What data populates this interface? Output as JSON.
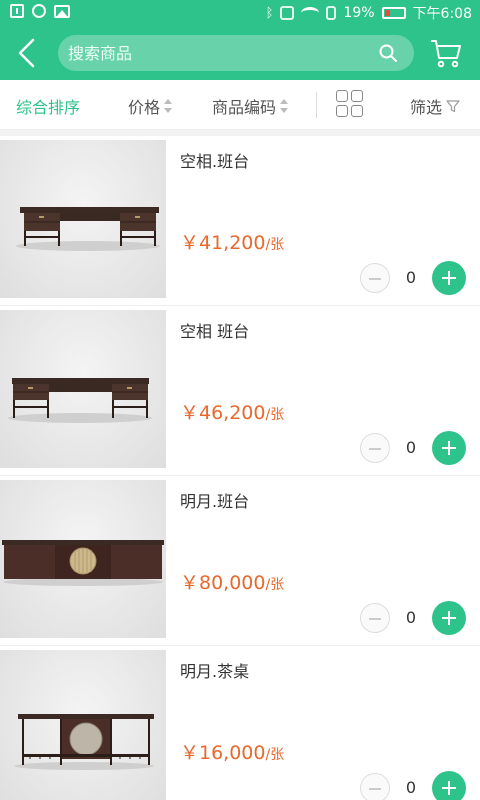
{
  "status_bar": {
    "battery": "19%",
    "time": "下午6:08"
  },
  "header": {
    "search_placeholder": "搜索商品"
  },
  "sort_bar": {
    "comprehensive": "综合排序",
    "price": "价格",
    "code": "商品编码",
    "filter": "筛选"
  },
  "colors": {
    "accent": "#2ec38a",
    "price": "#e8692d"
  },
  "products": [
    {
      "name": "空相.班台",
      "price": "￥41,200",
      "unit": "/张",
      "qty": "0"
    },
    {
      "name": "空相 班台",
      "price": "￥46,200",
      "unit": "/张",
      "qty": "0"
    },
    {
      "name": "明月.班台",
      "price": "￥80,000",
      "unit": "/张",
      "qty": "0"
    },
    {
      "name": "明月.茶桌",
      "price": "￥16,000",
      "unit": "/张",
      "qty": "0"
    }
  ]
}
